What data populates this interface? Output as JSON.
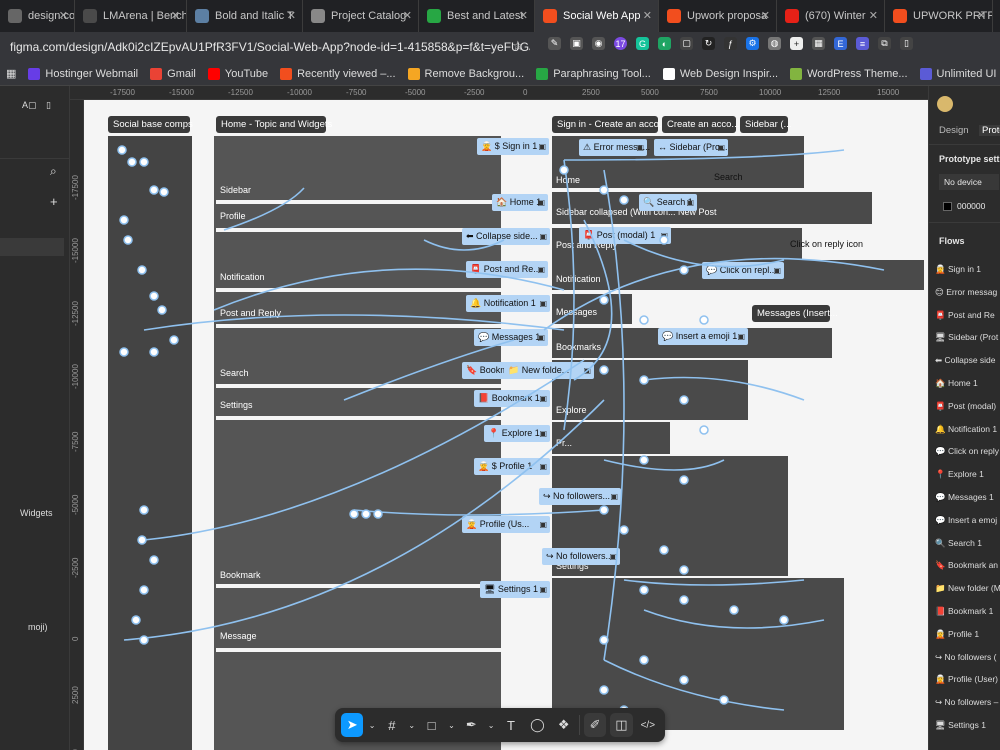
{
  "browser": {
    "tabs": [
      {
        "label": "design.com",
        "color": "#666"
      },
      {
        "label": "LMArena | Bench",
        "color": "#4a4a4a"
      },
      {
        "label": "Bold and Italic T",
        "color": "#5c7fa3"
      },
      {
        "label": "Project Catalog",
        "color": "#888"
      },
      {
        "label": "Best and Latest",
        "color": "#27a744"
      },
      {
        "label": "Social Web App",
        "color": "#f24e1e",
        "active": true
      },
      {
        "label": "Upwork proposa",
        "color": "#f24e1e"
      },
      {
        "label": "(670) Winter",
        "color": "#e62117"
      },
      {
        "label": "UPWORK PRTFC",
        "color": "#f24e1e"
      }
    ],
    "url": "figma.com/design/Adk0i2cIZEpvAU1PfR3FV1/Social-Web-App?node-id=1-415858&p=f&t=yeFUGJGd4...",
    "ext_badge": "17",
    "bookmarks": [
      {
        "label": "Hostinger Webmail",
        "color": "#673de6"
      },
      {
        "label": "Gmail",
        "color": "#ea4335"
      },
      {
        "label": "YouTube",
        "color": "#ff0000"
      },
      {
        "label": "Recently viewed –...",
        "color": "#f24e1e"
      },
      {
        "label": "Remove Backgrou...",
        "color": "#f5a623"
      },
      {
        "label": "Paraphrasing Tool...",
        "color": "#27a744"
      },
      {
        "label": "Web Design Inspir...",
        "color": "#fff"
      },
      {
        "label": "WordPress Theme...",
        "color": "#82b440"
      },
      {
        "label": "Unlimited UI Kits, I...",
        "color": "#5b5bd6"
      }
    ]
  },
  "ruler": {
    "top": [
      "-17500",
      "-15000",
      "-12500",
      "-10000",
      "-7500",
      "-5000",
      "-2500",
      "0",
      "2500",
      "5000",
      "7500",
      "10000",
      "12500",
      "15000"
    ],
    "left": [
      "-17500",
      "-15000",
      "-12500",
      "-10000",
      "-7500",
      "-5000",
      "-2500",
      "0",
      "2500",
      "5000"
    ]
  },
  "left_panel": {
    "item1": "Widgets",
    "item2": "moji)"
  },
  "canvas": {
    "sections": [
      {
        "label": "Social base comps"
      },
      {
        "label": "Home - Topic and Widgets"
      },
      {
        "label": "Sign in - Create an acco..."
      },
      {
        "label": "Create an acco..."
      },
      {
        "label": "Sidebar (..."
      },
      {
        "label": "Messages (Insert..."
      }
    ],
    "frame_labels": [
      "Sidebar",
      "Profile",
      "Notification",
      "Post and Reply",
      "Search",
      "Settings",
      "Bookmark",
      "Message"
    ],
    "right_labels": [
      "Home",
      "Sidebar collapsed (With con...",
      "New Post",
      "Post and Reply",
      "Notification",
      "Messages",
      "Bookmarks",
      "Explore",
      "Pr...",
      "Settings"
    ],
    "flows": [
      {
        "label": "🧝 $ Sign in 1"
      },
      {
        "label": "🏠 Home 1"
      },
      {
        "label": "⬅ Collapse side..."
      },
      {
        "label": "📮 Post and Re..."
      },
      {
        "label": "🔔 Notification 1"
      },
      {
        "label": "💬 Messages 1"
      },
      {
        "label": "🔖 Bookm..."
      },
      {
        "label": "📕 Bookmark 1"
      },
      {
        "label": "📍 Explore 1"
      },
      {
        "label": "🧝 $ Profile 1"
      },
      {
        "label": "🧝 Profile (Us..."
      },
      {
        "label": "🖥 Settings 1"
      },
      {
        "label": "⚠ Error messa..."
      },
      {
        "label": "↔ Sidebar (Pro..."
      },
      {
        "label": "📮 Post (modal) 1"
      },
      {
        "label": "💬 Insert a emoji 1"
      },
      {
        "label": "📁 New folde..."
      },
      {
        "label": "↪ No followers..."
      },
      {
        "label": "↪ No followers..."
      },
      {
        "label": "🔍 Search 1"
      },
      {
        "label": "💬 Click on repl..."
      }
    ],
    "overlay_labels": [
      "Search",
      "Click on reply icon"
    ]
  },
  "toolbar": {
    "move": "➤",
    "frame": "#",
    "shape": "□",
    "pen": "✒",
    "text": "T",
    "comment": "◯",
    "components": "❖",
    "dev": "</>"
  },
  "right_panel": {
    "tab_design": "Design",
    "tab_prototype": "Proto",
    "settings_title": "Prototype settin",
    "device": "No device",
    "color_value": "000000",
    "flows_title": "Flows",
    "flows": [
      "🧝 Sign in 1",
      "😊 Error messag",
      "📮 Post and Re",
      "🖥 Sidebar (Prot",
      "⬅ Collapse side",
      "🏠 Home 1",
      "📮 Post (modal)",
      "🔔 Notification 1",
      "💬 Click on reply",
      "📍 Explore 1",
      "💬 Messages 1",
      "💬 Insert a emoj",
      "🔍 Search 1",
      "🔖 Bookmark an",
      "📁 New folder (M",
      "📕 Bookmark 1",
      "🧝 Profile 1",
      "↪ No followers (",
      "🧝 Profile (User)",
      "↪ No followers –",
      "🖥 Settings 1"
    ]
  }
}
